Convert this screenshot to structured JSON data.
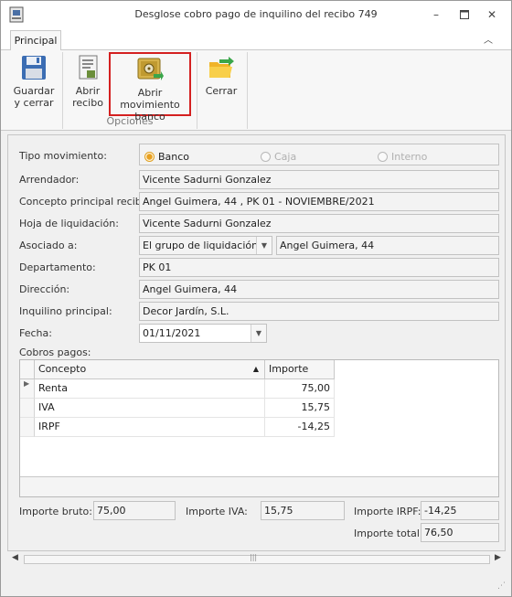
{
  "window": {
    "title": "Desglose cobro pago de inquilino del recibo 749"
  },
  "ribbon": {
    "tab": "Principal",
    "buttons": {
      "save_line1": "Guardar",
      "save_line2": "y cerrar",
      "open_line1": "Abrir",
      "open_line2": "recibo",
      "bank_line1": "Abrir movimiento",
      "bank_line2": "banco",
      "close": "Cerrar"
    },
    "group_label": "Opciones"
  },
  "form": {
    "tipo_label": "Tipo movimiento:",
    "tipo_options": [
      "Banco",
      "Caja",
      "Interno"
    ],
    "tipo_selected": "Banco",
    "arrendador_label": "Arrendador:",
    "arrendador": "Vicente Sadurni Gonzalez",
    "concepto_label": "Concepto  principal recibo:",
    "concepto": "Angel Guimera, 44 , PK 01 - NOVIEMBRE/2021",
    "hoja_label": "Hoja de liquidación:",
    "hoja": "Vicente Sadurni Gonzalez",
    "asociado_label": "Asociado a:",
    "asociado_tipo": "El grupo de liquidación",
    "asociado_valor": "Angel Guimera, 44",
    "departamento_label": "Departamento:",
    "departamento": "PK 01",
    "direccion_label": "Dirección:",
    "direccion": "Angel Guimera, 44",
    "inquilino_label": "Inquilino principal:",
    "inquilino": "Decor Jardín, S.L.",
    "fecha_label": "Fecha:",
    "fecha": "01/11/2021",
    "cobros_label": "Cobros pagos:"
  },
  "grid": {
    "columns": [
      "Concepto",
      "Importe"
    ],
    "rows": [
      {
        "concepto": "Renta",
        "importe": "75,00"
      },
      {
        "concepto": "IVA",
        "importe": "15,75"
      },
      {
        "concepto": "IRPF",
        "importe": "-14,25"
      }
    ]
  },
  "totals": {
    "bruto_label": "Importe bruto:",
    "bruto": "75,00",
    "iva_label": "Importe IVA:",
    "iva": "15,75",
    "irpf_label": "Importe IRPF:",
    "irpf": "-14,25",
    "total_label": "Importe total:",
    "total": "76,50"
  },
  "colors": {
    "highlight_border": "#d42020",
    "radio_selected": "#e8a020"
  }
}
